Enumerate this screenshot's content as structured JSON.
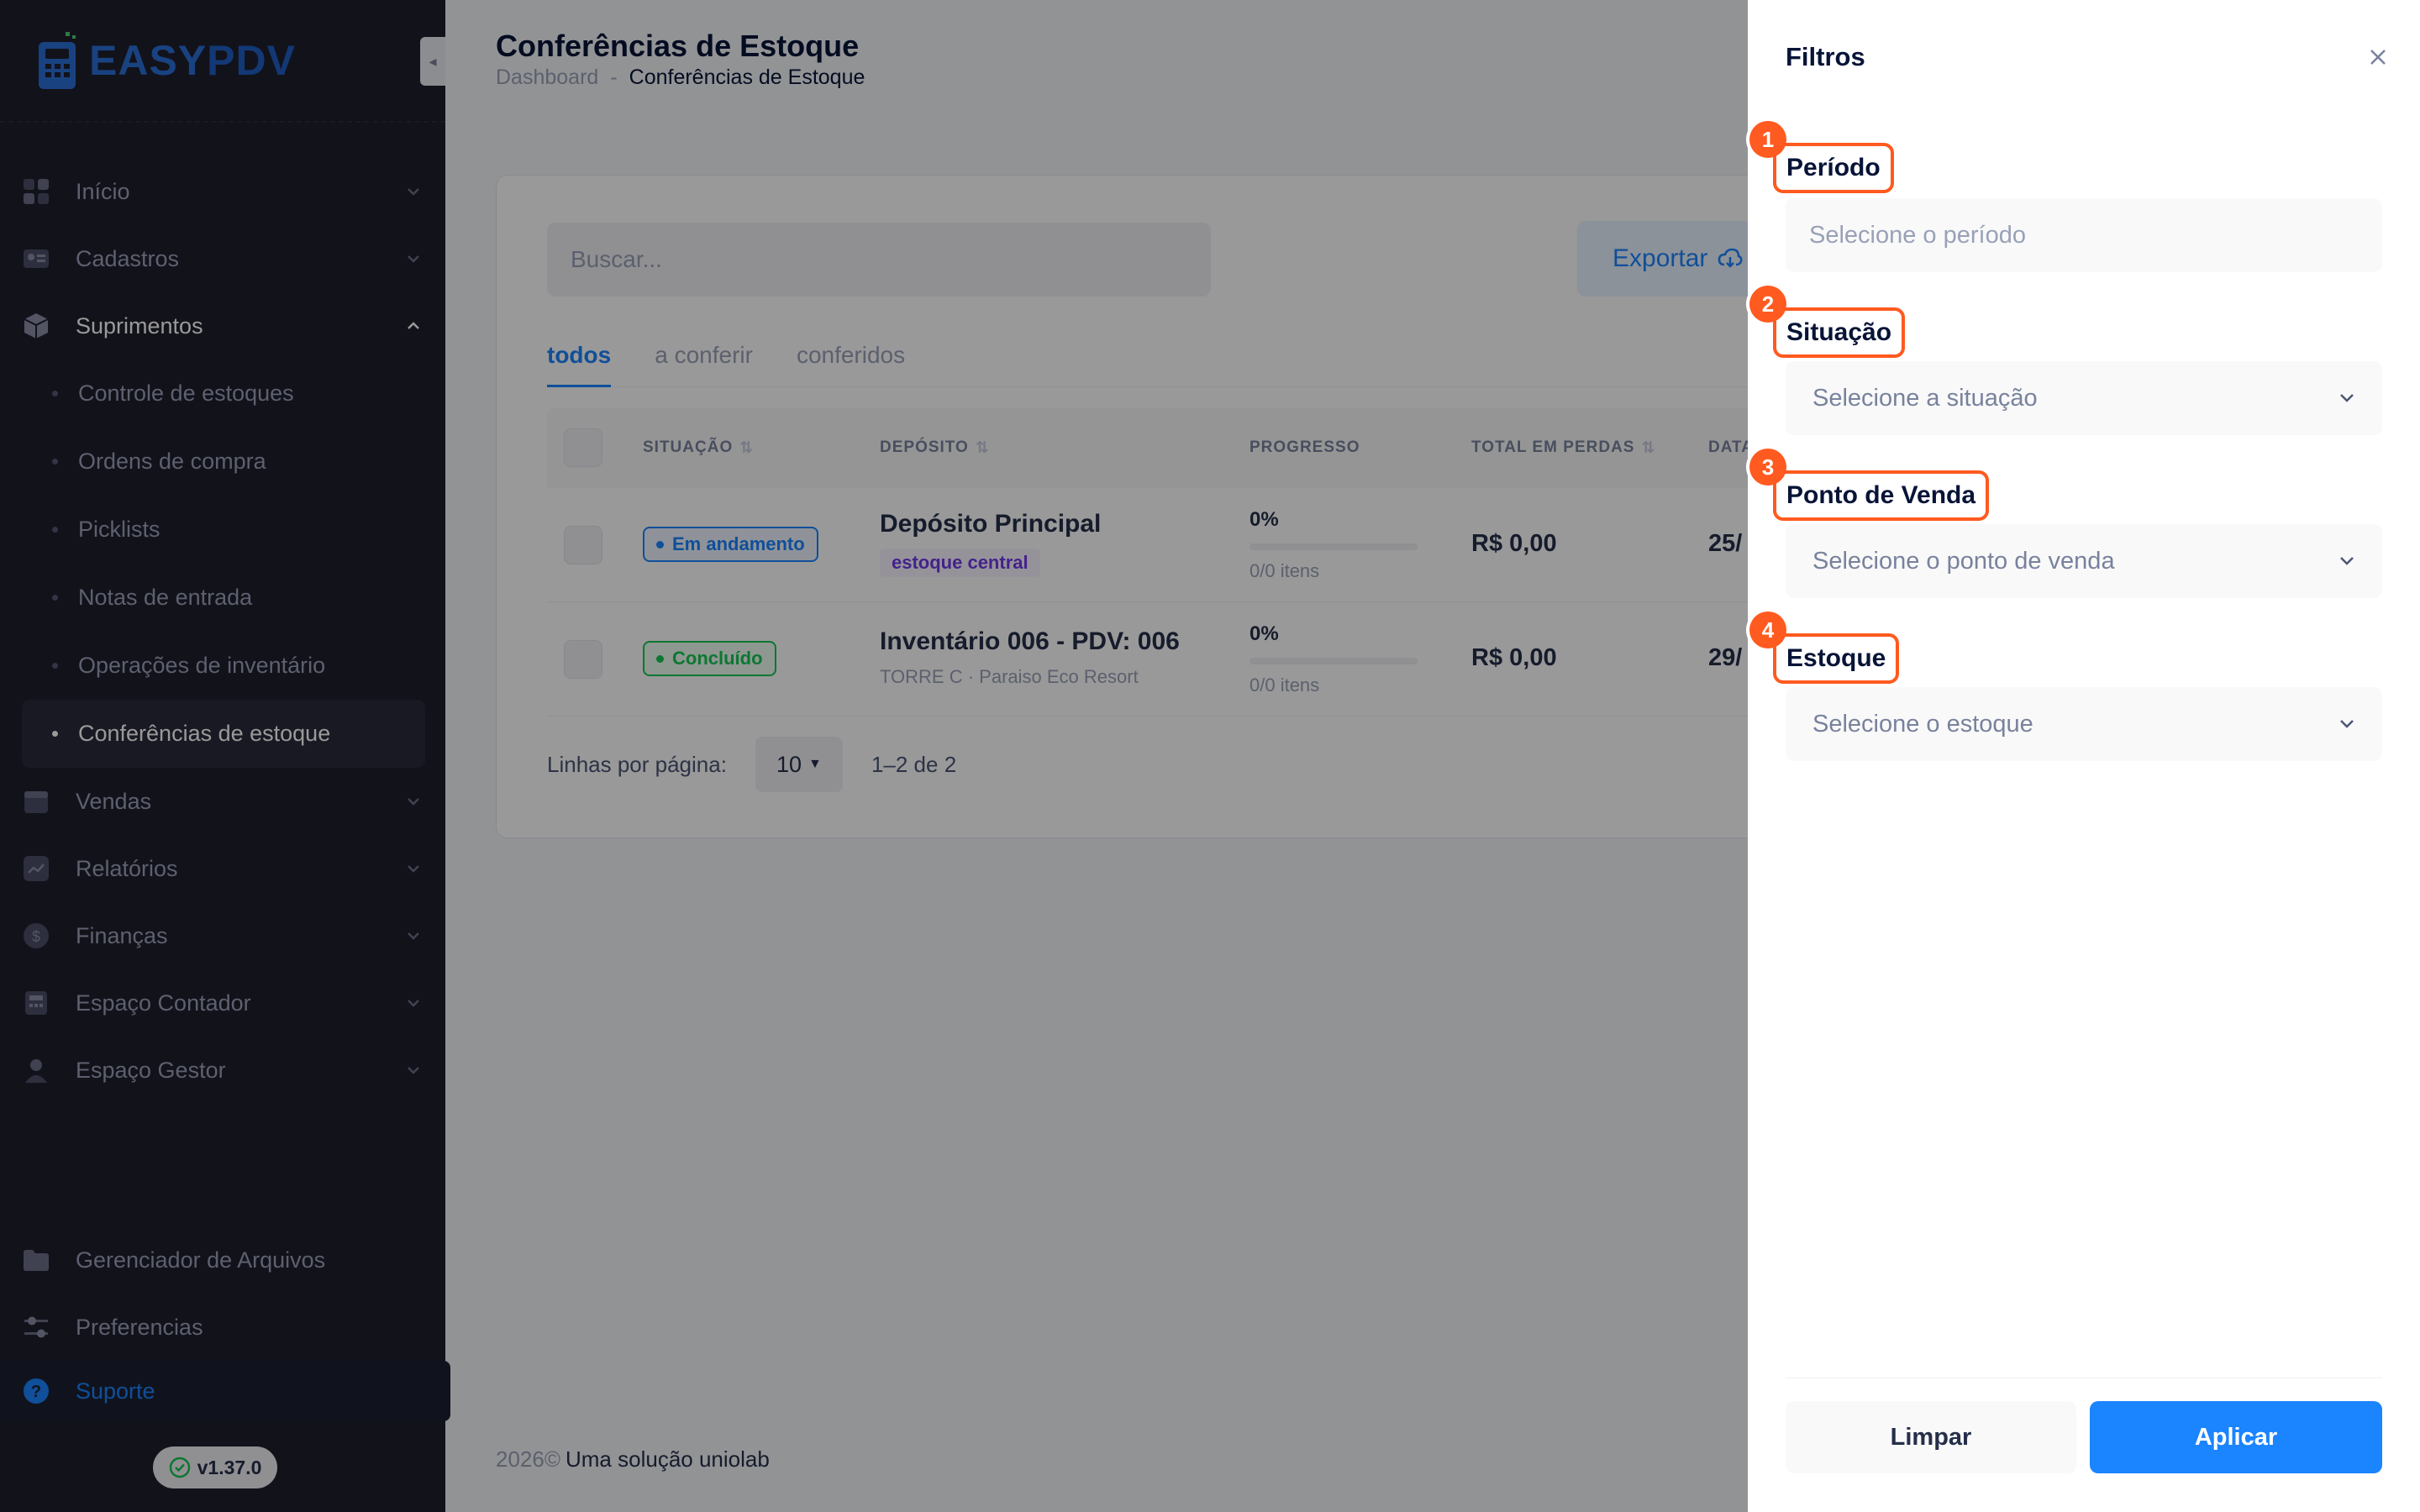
{
  "brand": {
    "logo_text_1": "EASY",
    "logo_text_2": "PDV"
  },
  "sidebar": {
    "items": [
      {
        "label": "Início",
        "icon": "grid-icon"
      },
      {
        "label": "Cadastros",
        "icon": "address-card-icon"
      },
      {
        "label": "Suprimentos",
        "icon": "box-icon"
      }
    ],
    "sub_items": [
      {
        "label": "Controle de estoques"
      },
      {
        "label": "Ordens de compra"
      },
      {
        "label": "Picklists"
      },
      {
        "label": "Notas de entrada"
      },
      {
        "label": "Operações de inventário"
      },
      {
        "label": "Conferências de estoque"
      }
    ],
    "items_after": [
      {
        "label": "Vendas",
        "icon": "calendar-icon"
      },
      {
        "label": "Relatórios",
        "icon": "chart-line-icon"
      },
      {
        "label": "Finanças",
        "icon": "dollar-icon"
      },
      {
        "label": "Espaço Contador",
        "icon": "calculator-icon"
      },
      {
        "label": "Espaço Gestor",
        "icon": "user-icon"
      }
    ],
    "bottom": [
      {
        "label": "Gerenciador de Arquivos",
        "icon": "folder-icon"
      },
      {
        "label": "Preferencias",
        "icon": "sliders-icon"
      },
      {
        "label": "Suporte",
        "icon": "question-icon"
      }
    ],
    "version": "v1.37.0"
  },
  "header": {
    "title": "Conferências de Estoque",
    "breadcrumb": [
      "Dashboard",
      "-",
      "Conferências de Estoque"
    ]
  },
  "toolbar": {
    "search_placeholder": "Buscar...",
    "export_label": "Exportar"
  },
  "tabs": [
    {
      "label": "todos",
      "active": true
    },
    {
      "label": "a conferir",
      "active": false
    },
    {
      "label": "conferidos",
      "active": false
    }
  ],
  "table": {
    "headers": [
      "SITUAÇÃO",
      "DEPÓSITO",
      "PROGRESSO",
      "TOTAL EM PERDAS",
      "DATA"
    ],
    "rows": [
      {
        "status": "Em andamento",
        "status_color": "#1b84ff",
        "deposit": "Depósito Principal",
        "deposit_tag": "estoque central",
        "progress_pct": "0%",
        "progress_value": 0,
        "progress_items": "0/0 itens",
        "loss": "R$ 0,00",
        "date": "25/"
      },
      {
        "status": "Concluído",
        "status_color": "#17c653",
        "deposit": "Inventário 006 - PDV: 006",
        "deposit_sub": "TORRE C · Paraiso Eco Resort",
        "progress_pct": "0%",
        "progress_value": 0,
        "progress_items": "0/0 itens",
        "loss": "R$ 0,00",
        "date": "29/"
      }
    ]
  },
  "pagination": {
    "rows_label": "Linhas por página:",
    "rows_value": "10",
    "range": "1–2 de 2"
  },
  "footer": {
    "year": "2026©",
    "text": "Uma solução uniolab"
  },
  "drawer": {
    "title": "Filtros",
    "fields": [
      {
        "step": "1",
        "label": "Período",
        "placeholder": "Selecione o período"
      },
      {
        "step": "2",
        "label": "Situação",
        "placeholder": "Selecione a situação"
      },
      {
        "step": "3",
        "label": "Ponto de Venda",
        "placeholder": "Selecione o ponto de venda"
      },
      {
        "step": "4",
        "label": "Estoque",
        "placeholder": "Selecione o estoque"
      }
    ],
    "clear_label": "Limpar",
    "apply_label": "Aplicar"
  },
  "colors": {
    "accent": "#1b84ff",
    "sidebar_bg": "#1e1e2d",
    "highlight": "#ff5a1f",
    "success": "#17c653"
  }
}
